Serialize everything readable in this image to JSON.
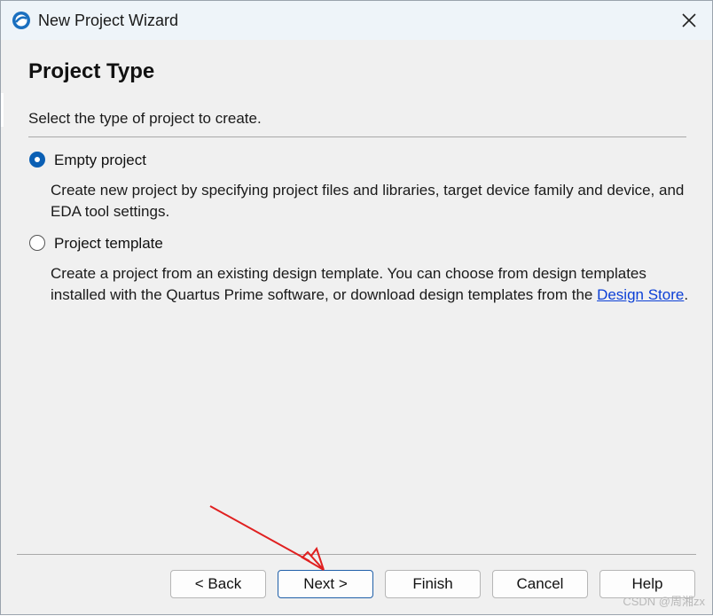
{
  "window": {
    "title": "New Project Wizard",
    "app_icon": "quartus-logo-icon",
    "close_icon": "close-icon"
  },
  "page": {
    "title": "Project Type",
    "subtitle": "Select the type of project to create."
  },
  "options": [
    {
      "label": "Empty project",
      "selected": true,
      "description": "Create new project by specifying project files and libraries, target device family and device, and EDA tool settings."
    },
    {
      "label": "Project template",
      "selected": false,
      "description_before_link": "Create a project from an existing design template. You can choose from design templates installed with the Quartus Prime software, or download design templates from the ",
      "link_text": "Design Store",
      "description_after_link": "."
    }
  ],
  "buttons": {
    "back": "< Back",
    "next": "Next >",
    "finish": "Finish",
    "cancel": "Cancel",
    "help": "Help"
  },
  "annotation": {
    "arrow_color": "#e02020"
  },
  "watermark": "CSDN @周湘zx"
}
